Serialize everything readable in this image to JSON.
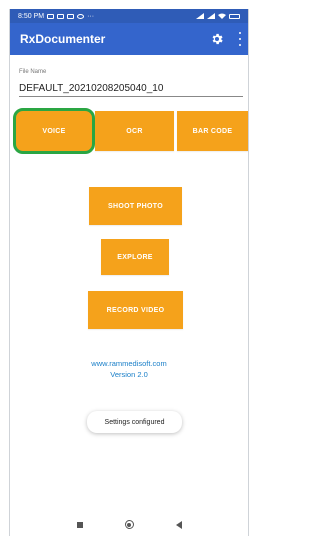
{
  "status": {
    "time": "8:50 PM",
    "left_icons": [
      "notification-icon",
      "message-icon",
      "camera-icon",
      "whatsapp-icon",
      "more-icon"
    ],
    "right_icons": [
      "signal-icon",
      "signal-icon",
      "wifi-icon",
      "battery-icon"
    ]
  },
  "appbar": {
    "title": "RxDocumenter",
    "settings_icon": "gear-icon",
    "menu_icon": "kebab-icon",
    "color": "#3465cc"
  },
  "file_name": {
    "label": "File Name",
    "value": "DEFAULT_20210208205040_10"
  },
  "tabs": [
    {
      "label": "VOICE"
    },
    {
      "label": "OCR"
    },
    {
      "label": "BAR CODE"
    }
  ],
  "actions": {
    "shoot_photo": "SHOOT PHOTO",
    "explore": "EXPLORE",
    "record_video": "RECORD VIDEO"
  },
  "footer": {
    "website": "www.rammedisoft.com",
    "version": "Version 2.0"
  },
  "toast": "Settings configured",
  "colors": {
    "accent": "#f5a21b",
    "highlight": "#2aa643",
    "link": "#1a7fc8"
  }
}
